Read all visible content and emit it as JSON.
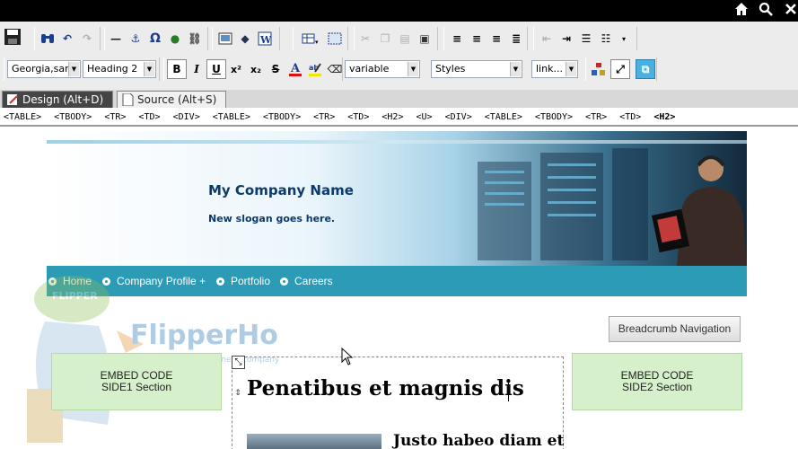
{
  "topbar": {
    "icons": [
      "home-icon",
      "search-icon",
      "close-icon"
    ]
  },
  "toolbar": {
    "font_family": "Georgia,san",
    "block_format": "Heading 2",
    "font_size": "variable",
    "styles": "Styles",
    "link": "link..."
  },
  "tabs": {
    "design": "Design (Alt+D)",
    "source": "Source (Alt+S)"
  },
  "tag_path": [
    "<TABLE>",
    "<TBODY>",
    "<TR>",
    "<TD>",
    "<DIV>",
    "<TABLE>",
    "<TBODY>",
    "<TR>",
    "<TD>",
    "<H2>",
    "<U>",
    "<DIV>",
    "<TABLE>",
    "<TBODY>",
    "<TR>",
    "<TD>",
    "<H2>"
  ],
  "page": {
    "company_name": "My Company Name",
    "slogan": "New slogan goes here.",
    "nav": [
      "Home",
      "Company Profile +",
      "Portfolio",
      "Careers"
    ],
    "breadcrumb": "Breadcrumb Navigation",
    "side1": {
      "line1": "EMBED CODE",
      "line2": "SIDE1 Section"
    },
    "side2": {
      "line1": "EMBED CODE",
      "line2": "SIDE2 Section"
    },
    "heading": "Penatibus et magnis dis",
    "subheading": "Justo habeo diam et"
  },
  "watermark": {
    "brand": "FlipperHost",
    "tagline": "an investment company",
    "cap_text": "FLIPPER"
  }
}
